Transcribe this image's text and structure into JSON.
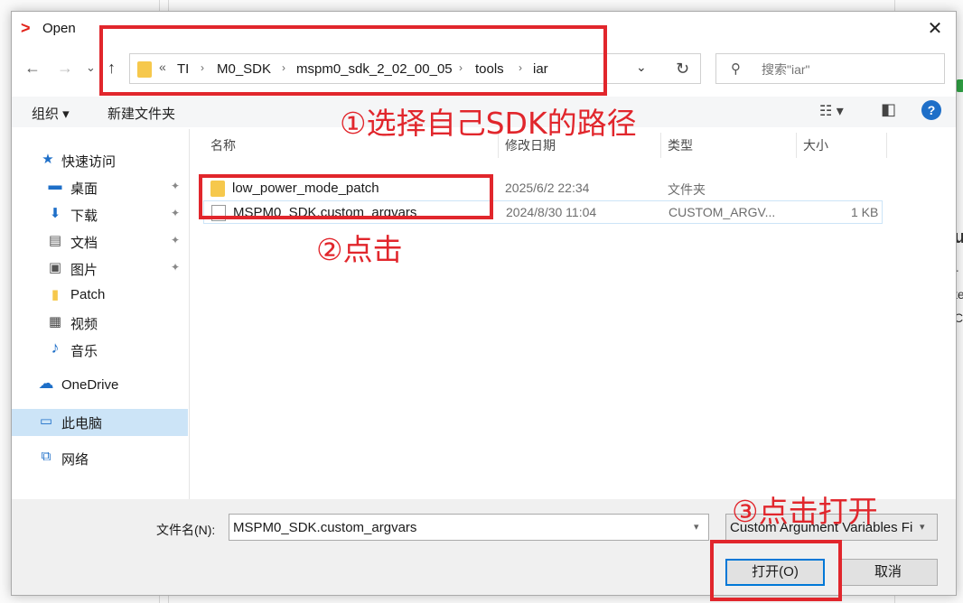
{
  "window": {
    "title": "Open",
    "close_symbol": "✕"
  },
  "nav": {
    "back": "←",
    "forward": "→",
    "recent": "⌄",
    "up": "↑"
  },
  "address": {
    "overflow": "«",
    "crumbs": [
      "TI",
      "M0_SDK",
      "mspm0_sdk_2_02_00_05",
      "tools",
      "iar"
    ],
    "separator": "›",
    "dropdown": "⌄",
    "refresh": "↻"
  },
  "search": {
    "placeholder": "搜索\"iar\"",
    "icon": "search-icon"
  },
  "toolbar": {
    "organize": "组织 ▾",
    "new_folder": "新建文件夹",
    "view_icon": "☷ ▾",
    "pane_icon": "◧",
    "help": "?"
  },
  "sidebar": {
    "items": [
      {
        "label": "快速访问",
        "icon": "★"
      },
      {
        "label": "桌面",
        "icon": "▬"
      },
      {
        "label": "下载",
        "icon": "⬇"
      },
      {
        "label": "文档",
        "icon": "▤"
      },
      {
        "label": "图片",
        "icon": "▣"
      },
      {
        "label": "Patch",
        "icon": "▮"
      },
      {
        "label": "视频",
        "icon": "▦"
      },
      {
        "label": "音乐",
        "icon": "♪"
      },
      {
        "label": "OneDrive",
        "icon": "☁"
      },
      {
        "label": "此电脑",
        "icon": "▭"
      },
      {
        "label": "网络",
        "icon": "⧉"
      }
    ],
    "pin": "📌"
  },
  "columns": {
    "name": "名称",
    "modified": "修改日期",
    "type": "类型",
    "size": "大小"
  },
  "files": [
    {
      "name": "low_power_mode_patch",
      "modified": "2025/6/2 22:34",
      "type": "文件夹",
      "size": ""
    },
    {
      "name": "MSPM0_SDK.custom_argvars",
      "modified": "2024/8/30 11:04",
      "type": "CUSTOM_ARGV...",
      "size": "1 KB"
    }
  ],
  "footer": {
    "filename_label": "文件名(N):",
    "filename_value": "MSPM0_SDK.custom_argvars",
    "filetype_value": "Custom Argument Variables Fi",
    "open_label": "打开(O)",
    "cancel_label": "取消"
  },
  "annotations": {
    "step1": "①选择自己SDK的路径",
    "step2": "②点击",
    "step3": "③点击打开",
    "color": "#e1262c"
  },
  "background": {
    "partial_texts": [
      "u",
      "r",
      "te",
      "C"
    ]
  }
}
